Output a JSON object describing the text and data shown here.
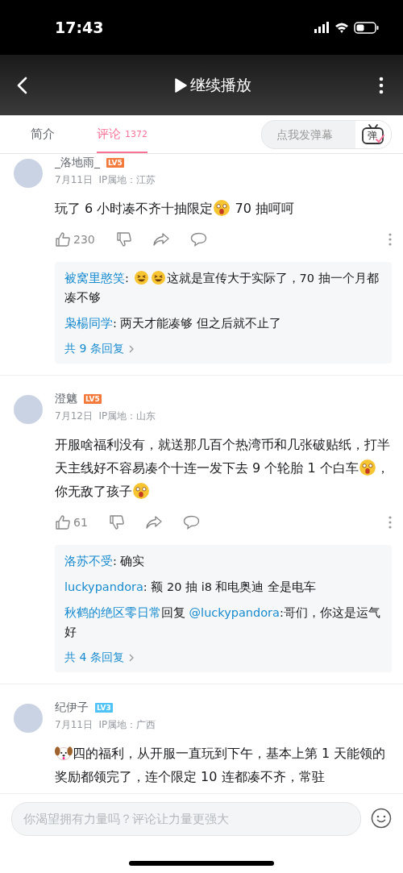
{
  "status_bar": {
    "time": "17:43"
  },
  "nav": {
    "title": "继续播放"
  },
  "tabs": [
    {
      "label": "简介",
      "selected": false
    },
    {
      "label": "评论",
      "count": "1372",
      "selected": true
    }
  ],
  "danmaku": {
    "placeholder": "点我发弹幕",
    "icon_text": "弹"
  },
  "comments": [
    {
      "user": "_洛地雨_",
      "level": "LV5",
      "color": "#f37a3b",
      "date": "7月11日",
      "ip": "IP属地：江苏",
      "body": [
        {
          "kind": "text",
          "text": "玩了 6 小时凑不齐十抽限定"
        },
        {
          "kind": "face"
        },
        {
          "kind": "text",
          "text": " 70 抽呵呵"
        }
      ],
      "likes": "230",
      "replies": [
        {
          "user": "被窝里憨笑",
          "body": [
            {
              "kind": "text",
              "text": ": "
            },
            {
              "kind": "face"
            },
            {
              "kind": "face"
            },
            {
              "kind": "text",
              "text": "这就是宣传大于实际了，70 抽一个月都凑不够"
            }
          ]
        },
        {
          "user": "枭楊同学",
          "body": [
            {
              "kind": "text",
              "text": ": 两天才能凑够 但之后就不止了"
            }
          ]
        }
      ],
      "reply_count": "共 9 条回复"
    },
    {
      "user": "澄魑",
      "level": "LV5",
      "color": "#f37a3b",
      "date": "7月12日",
      "ip": "IP属地：山东",
      "body": [
        {
          "kind": "text",
          "text": "开服啥福利没有，就送那几百个热湾币和几张破贴纸，打半天主线好不容易凑个十连一发下去 9 个轮胎 1 个白车"
        },
        {
          "kind": "face"
        },
        {
          "kind": "text",
          "text": "，你无敌了孩子"
        },
        {
          "kind": "face"
        }
      ],
      "likes": "61",
      "replies": [
        {
          "user": "洛苏不受",
          "body": [
            {
              "kind": "text",
              "text": ": 确实"
            }
          ]
        },
        {
          "user": "luckypandora",
          "body": [
            {
              "kind": "text",
              "text": ": 额 20 抽 i8 和电奥迪 全是电车"
            }
          ]
        },
        {
          "user": "秋鹤的绝区零日常",
          "reply_word": "回复",
          "reply_to": "@luckypandora",
          "body": [
            {
              "kind": "text",
              "text": ":哥们，你这是运气好"
            }
          ]
        }
      ],
      "reply_count": "共 4 条回复"
    },
    {
      "user": "纪伊子",
      "level": "LV3",
      "color": "#4fc3f7",
      "date": "7月11日",
      "ip": "IP属地：广西",
      "body": [
        {
          "kind": "dog"
        },
        {
          "kind": "text",
          "text": "四的福利，从开服一直玩到下午，基本上第 1 天能领的奖励都领完了，连个限定 10 连都凑不齐，常驻"
        }
      ]
    }
  ],
  "input": {
    "placeholder": "你渴望拥有力量吗？评论让力量更强大"
  }
}
